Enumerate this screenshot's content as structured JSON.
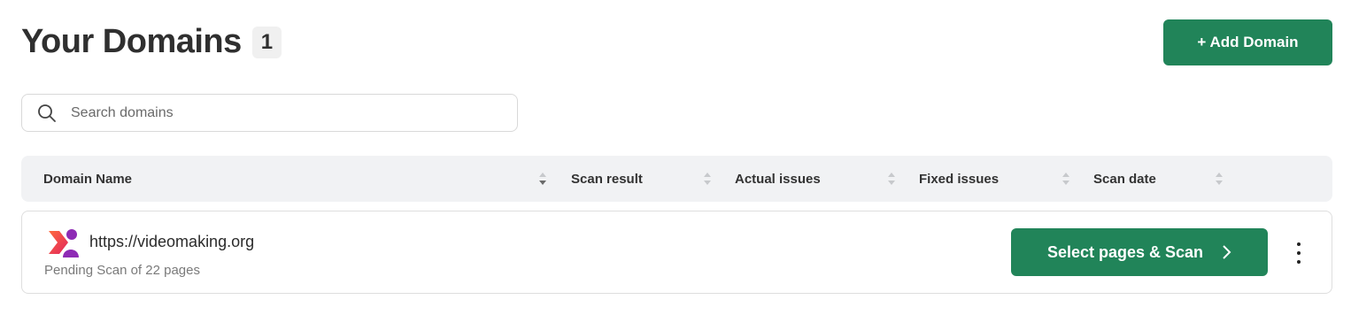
{
  "header": {
    "title": "Your Domains",
    "count": "1",
    "add_button": "+ Add Domain"
  },
  "search": {
    "placeholder": "Search domains",
    "value": ""
  },
  "table": {
    "columns": [
      "Domain Name",
      "Scan result",
      "Actual issues",
      "Fixed issues",
      "Scan date"
    ],
    "rows": [
      {
        "url": "https://videomaking.org",
        "status": "Pending Scan of 22 pages",
        "action_label": "Select pages & Scan"
      }
    ]
  },
  "colors": {
    "primary": "#218459",
    "header_bg": "#f1f2f4"
  },
  "icons": {
    "search": "search-icon",
    "sort": "sort-icon",
    "chevron": "chevron-right-icon",
    "more": "more-vertical-icon",
    "logo": "site-logo"
  }
}
